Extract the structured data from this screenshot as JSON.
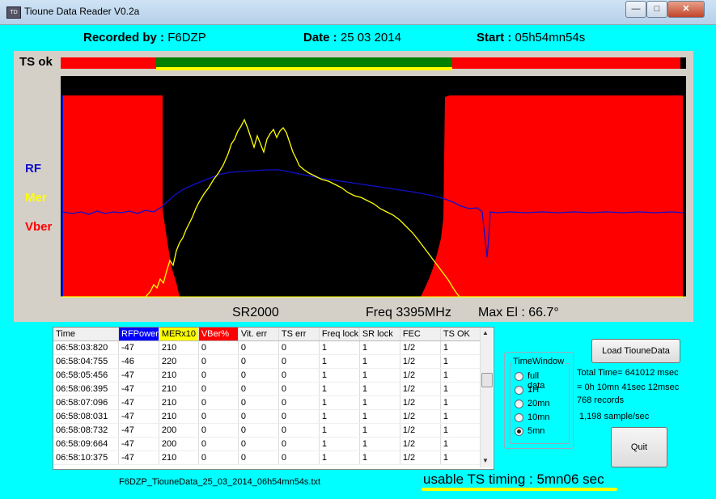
{
  "window": {
    "title": "Tioune Data Reader V0.2a",
    "icon": "app-icon",
    "icon_text": "TD"
  },
  "header": {
    "recorded_label": "Recorded by :",
    "recorded_value": "F6DZP",
    "date_label": "Date :",
    "date_value": "25 03 2014",
    "start_label": "Start :",
    "start_value": "05h54mn54s"
  },
  "plot": {
    "ts_label": "TS ok",
    "rf_label": "RF",
    "mer_label": "Mer",
    "vber_label": "Vber",
    "sr_label": "SR2000",
    "freq_label": "Freq 3395MHz",
    "maxel_label": "Max El : 66.7°",
    "colors": {
      "rf": "#1010cc",
      "mer": "#ffff00",
      "vber": "#ff0000",
      "tsok": "#008000"
    }
  },
  "grid": {
    "columns": [
      "Time",
      "RFPower",
      "MERx10",
      "VBer%",
      "Vit. err",
      "TS err",
      "Freq lock",
      "SR lock",
      "FEC",
      "TS OK"
    ],
    "rows": [
      [
        "06:58:03:820",
        "-47",
        "210",
        "0",
        "0",
        "0",
        "1",
        "1",
        "1/2",
        "1"
      ],
      [
        "06:58:04:755",
        "-46",
        "220",
        "0",
        "0",
        "0",
        "1",
        "1",
        "1/2",
        "1"
      ],
      [
        "06:58:05:456",
        "-47",
        "210",
        "0",
        "0",
        "0",
        "1",
        "1",
        "1/2",
        "1"
      ],
      [
        "06:58:06:395",
        "-47",
        "210",
        "0",
        "0",
        "0",
        "1",
        "1",
        "1/2",
        "1"
      ],
      [
        "06:58:07:096",
        "-47",
        "210",
        "0",
        "0",
        "0",
        "1",
        "1",
        "1/2",
        "1"
      ],
      [
        "06:58:08:031",
        "-47",
        "210",
        "0",
        "0",
        "0",
        "1",
        "1",
        "1/2",
        "1"
      ],
      [
        "06:58:08:732",
        "-47",
        "200",
        "0",
        "0",
        "0",
        "1",
        "1",
        "1/2",
        "1"
      ],
      [
        "06:58:09:664",
        "-47",
        "200",
        "0",
        "0",
        "0",
        "1",
        "1",
        "1/2",
        "1"
      ],
      [
        "06:58:10:375",
        "-47",
        "210",
        "0",
        "0",
        "0",
        "1",
        "1",
        "1/2",
        "1"
      ]
    ]
  },
  "filename": "F6DZP_TiouneData_25_03_2014_06h54mn54s.txt",
  "usable": "usable TS timing : 5mn06 sec",
  "timewindow": {
    "title": "TimeWindow",
    "options": [
      "full data",
      "1H",
      "20mn",
      "10mn",
      "5mn"
    ],
    "selected": "5mn"
  },
  "buttons": {
    "load": "Load TiouneData",
    "quit": "Quit"
  },
  "info": {
    "total": "Total Time= 641012 msec",
    "breakdown": "= 0h  10mn  41sec  12msec",
    "records": "768 records",
    "rate": "1,198 sample/sec"
  }
}
